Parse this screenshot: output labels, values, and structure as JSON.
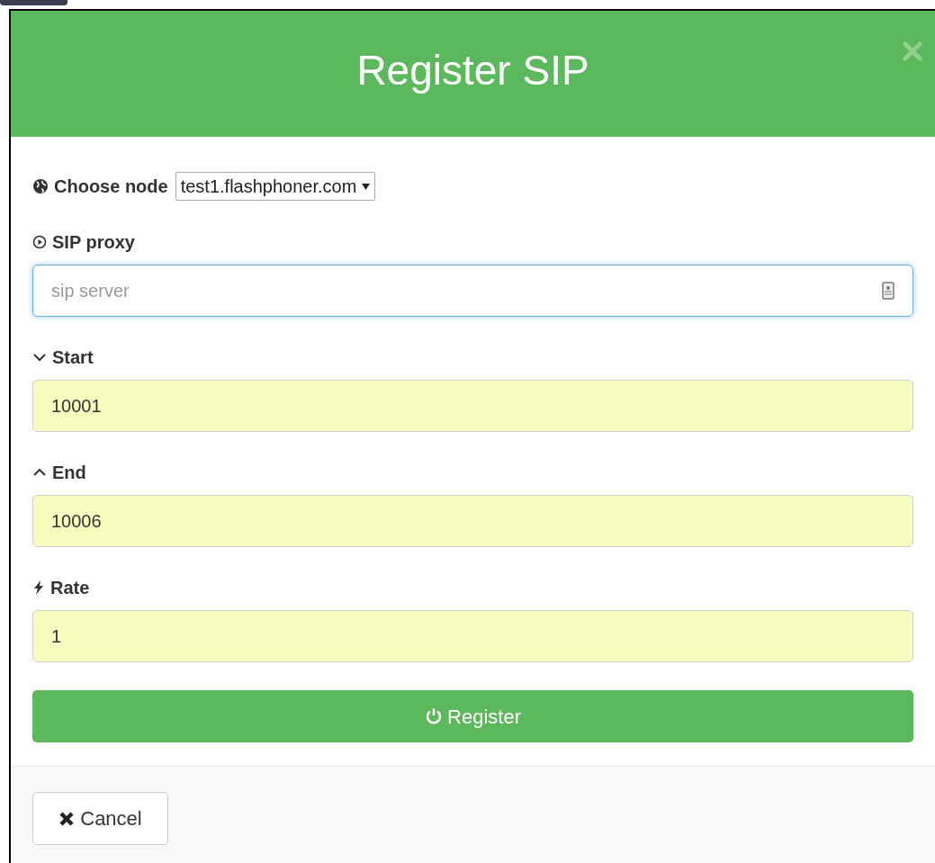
{
  "dialog": {
    "title": "Register SIP",
    "node": {
      "label": "Choose node",
      "value": "test1.flashphoner.com"
    },
    "fields": [
      {
        "label": "SIP proxy",
        "placeholder": "sip server",
        "focused": true,
        "autofilled": false
      },
      {
        "label": "Start",
        "value": "10001",
        "focused": false,
        "autofilled": true
      },
      {
        "label": "End",
        "value": "10006",
        "focused": false,
        "autofilled": true
      },
      {
        "label": "Rate",
        "value": "1",
        "focused": false,
        "autofilled": true
      }
    ],
    "submit": "Register",
    "cancel": "Cancel"
  }
}
